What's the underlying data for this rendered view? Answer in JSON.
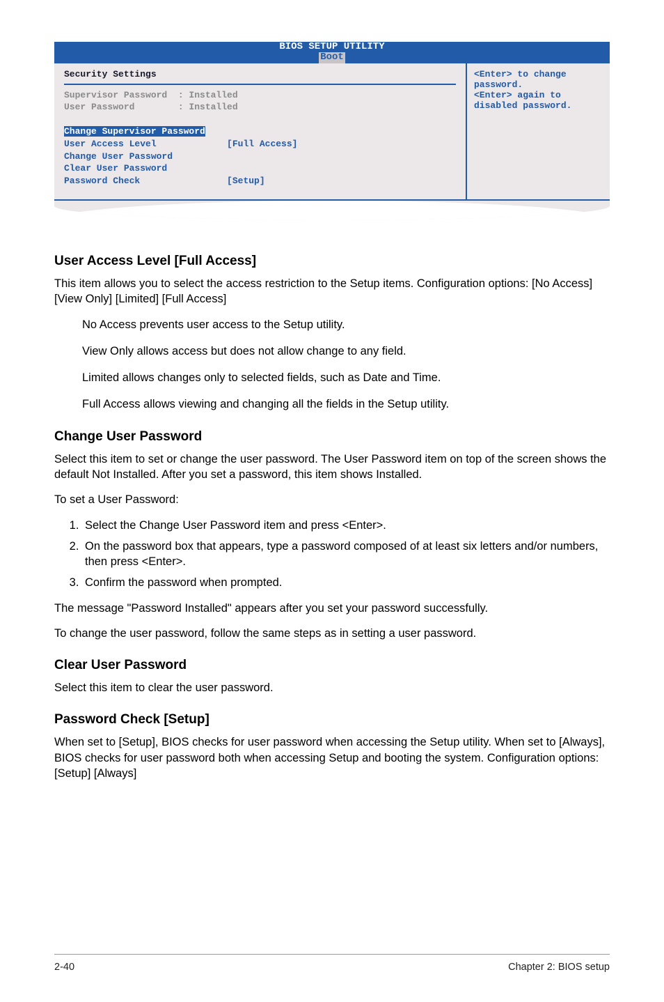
{
  "bios": {
    "title": "BIOS SETUP UTILITY",
    "tab": "Boot",
    "section_heading": "Security Settings",
    "rows": {
      "sup_label": "Supervisor Password  : Installed",
      "user_label": "User Password        : Installed",
      "change_sup": "Change Supervisor Password",
      "ual_label": "User Access Level",
      "ual_value": "[Full Access]",
      "cup": "Change User Password",
      "clp": "Clear User Password",
      "pwc_label": "Password Check",
      "pwc_value": "[Setup]"
    },
    "help1": "<Enter> to change",
    "help2": "password.",
    "help3": "<Enter> again to",
    "help4": "disabled password."
  },
  "sections": {
    "ual": {
      "heading": "User Access Level [Full Access]",
      "p1": "This item allows you to select the access restriction to the Setup items. Configuration options: [No Access] [View Only] [Limited] [Full Access]",
      "b1": "No Access prevents user access to the Setup utility.",
      "b2": "View Only allows access but does not allow change to any field.",
      "b3": "Limited allows changes only to selected fields, such as Date and Time.",
      "b4": "Full Access allows viewing and changing all the fields in the Setup utility."
    },
    "cup": {
      "heading": "Change User Password",
      "p1": "Select this item to set or change the user password. The User Password item on top of the screen shows the default Not Installed. After you set a password, this item shows Installed.",
      "p2": "To set a User Password:",
      "li1": "Select the Change User Password item and press <Enter>.",
      "li2": "On the password box that appears, type a password composed of at least six letters and/or numbers, then press <Enter>.",
      "li3": "Confirm the password when prompted.",
      "p3": "The message \"Password Installed\" appears after you set your password successfully.",
      "p4": "To change the user password, follow the same steps as in setting a user password."
    },
    "clp": {
      "heading": "Clear User Password",
      "p1": "Select this item to clear the user password."
    },
    "pwc": {
      "heading": "Password Check [Setup]",
      "p1": "When set to [Setup], BIOS checks for user password when accessing the Setup utility. When set to [Always], BIOS checks for user password both when accessing Setup and booting the system. Configuration options: [Setup] [Always]"
    }
  },
  "footer": {
    "left": "2-40",
    "right": "Chapter 2: BIOS setup"
  }
}
